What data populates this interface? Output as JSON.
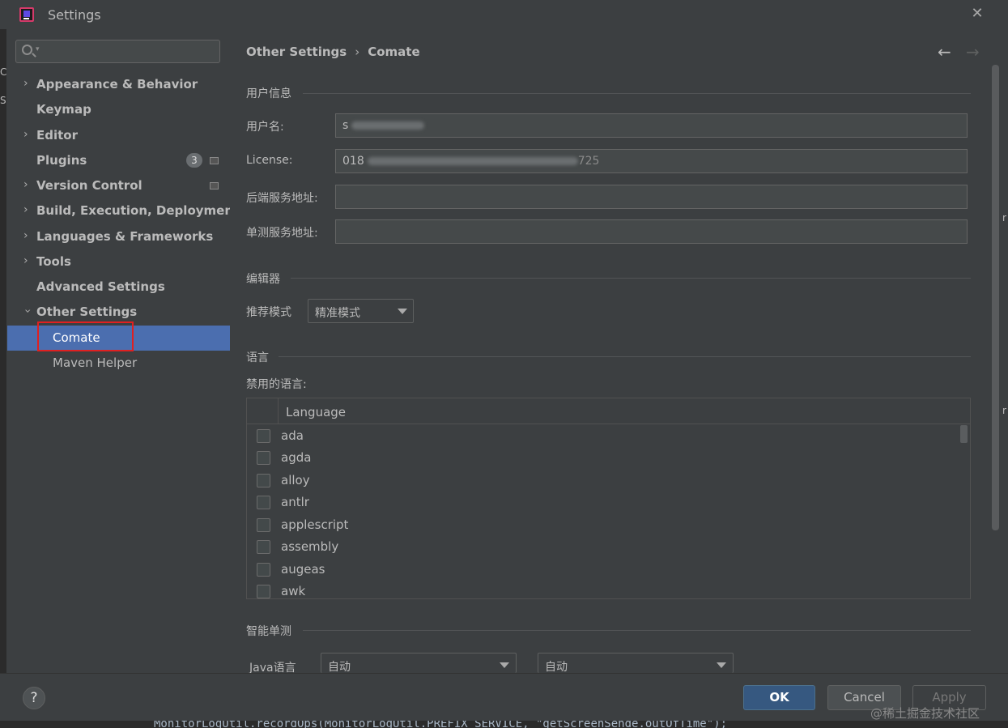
{
  "window": {
    "title": "Settings"
  },
  "search": {
    "placeholder": ""
  },
  "sidebar": {
    "items": [
      {
        "label": "Appearance & Behavior",
        "expandable": true
      },
      {
        "label": "Keymap",
        "expandable": false
      },
      {
        "label": "Editor",
        "expandable": true
      },
      {
        "label": "Plugins",
        "expandable": false,
        "badge": "3"
      },
      {
        "label": "Version Control",
        "expandable": true
      },
      {
        "label": "Build, Execution, Deployment",
        "expandable": true
      },
      {
        "label": "Languages & Frameworks",
        "expandable": true
      },
      {
        "label": "Tools",
        "expandable": true
      },
      {
        "label": "Advanced Settings",
        "expandable": false
      },
      {
        "label": "Other Settings",
        "expandable": true,
        "expanded": true
      }
    ],
    "subitems": [
      {
        "label": "Comate",
        "selected": true
      },
      {
        "label": "Maven Helper",
        "selected": false
      }
    ]
  },
  "breadcrumb": {
    "parent": "Other Settings",
    "separator": "›",
    "current": "Comate"
  },
  "sections": {
    "user_info": "用户信息",
    "editor": "编辑器",
    "language": "语言",
    "smart_test": "智能单测"
  },
  "fields": {
    "username": {
      "label": "用户名:",
      "value": "s"
    },
    "license": {
      "label": "License:",
      "value_prefix": "018",
      "value_suffix": "725"
    },
    "backend_url": {
      "label": "后端服务地址:",
      "value": ""
    },
    "test_url": {
      "label": "单测服务地址:",
      "value": ""
    }
  },
  "editor": {
    "mode_label": "推荐模式",
    "mode_value": "精准模式"
  },
  "languages": {
    "disabled_label": "禁用的语言:",
    "column_header": "Language",
    "items": [
      "ada",
      "agda",
      "alloy",
      "antlr",
      "applescript",
      "assembly",
      "augeas",
      "awk"
    ]
  },
  "smart_test": {
    "java_label": "Java语言",
    "combo1": "自动",
    "combo2": "自动"
  },
  "footer": {
    "help": "?",
    "ok": "OK",
    "cancel": "Cancel",
    "apply": "Apply"
  },
  "background": {
    "code": "MonitorLogUtil.recordOps(MonitorLogUtil.PREFIX_SERVICE, \"getScreenSende.outOfTime\");",
    "watermark": "@稀土掘金技术社区"
  },
  "colors": {
    "selection": "#4b6eaf",
    "ok_button": "#365880",
    "highlight": "#e02020"
  }
}
